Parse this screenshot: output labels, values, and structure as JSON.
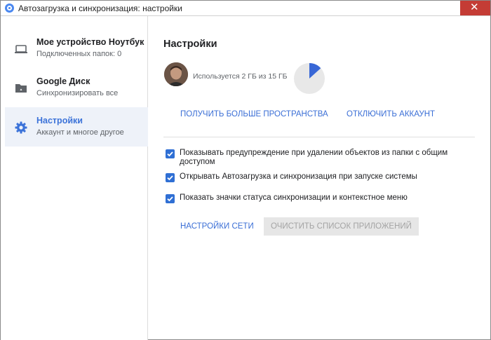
{
  "window": {
    "title": "Автозагрузка и синхронизация: настройки",
    "close_symbol": "✕"
  },
  "sidebar": {
    "items": [
      {
        "title": "Мое устройство Ноутбук",
        "subtitle": "Подключенных папок: 0",
        "icon": "laptop-icon",
        "active": false
      },
      {
        "title": "Google Диск",
        "subtitle": "Синхронизировать все",
        "icon": "drive-folder-icon",
        "active": false
      },
      {
        "title": "Настройки",
        "subtitle": "Аккаунт и многое другое",
        "icon": "gear-icon",
        "active": true
      }
    ]
  },
  "main": {
    "title": "Настройки",
    "storage": {
      "text": "Используется 2 ГБ из 15 ГБ",
      "used_gb": 2,
      "total_gb": 15
    },
    "get_more_space": "ПОЛУЧИТЬ БОЛЬШЕ ПРОСТРАНСТВА",
    "disconnect_account": "ОТКЛЮЧИТЬ АККАУНТ",
    "options": [
      {
        "label": "Показывать предупреждение при удалении объектов из папки с общим доступом",
        "checked": true
      },
      {
        "label": "Открывать Автозагрузка и синхронизация при запуске системы",
        "checked": true
      },
      {
        "label": "Показать значки статуса синхронизации и контекстное меню",
        "checked": true
      }
    ],
    "network_settings": "НАСТРОЙКИ СЕТИ",
    "clear_apps": "ОЧИСТИТЬ СПИСОК ПРИЛОЖЕНИЙ"
  },
  "colors": {
    "accent": "#3b6fd6",
    "checkbox": "#2f6fd4",
    "active_bg": "#eef2f9",
    "pie_used": "#3867d6",
    "pie_free": "#e8e8e8",
    "close": "#c43c35"
  }
}
